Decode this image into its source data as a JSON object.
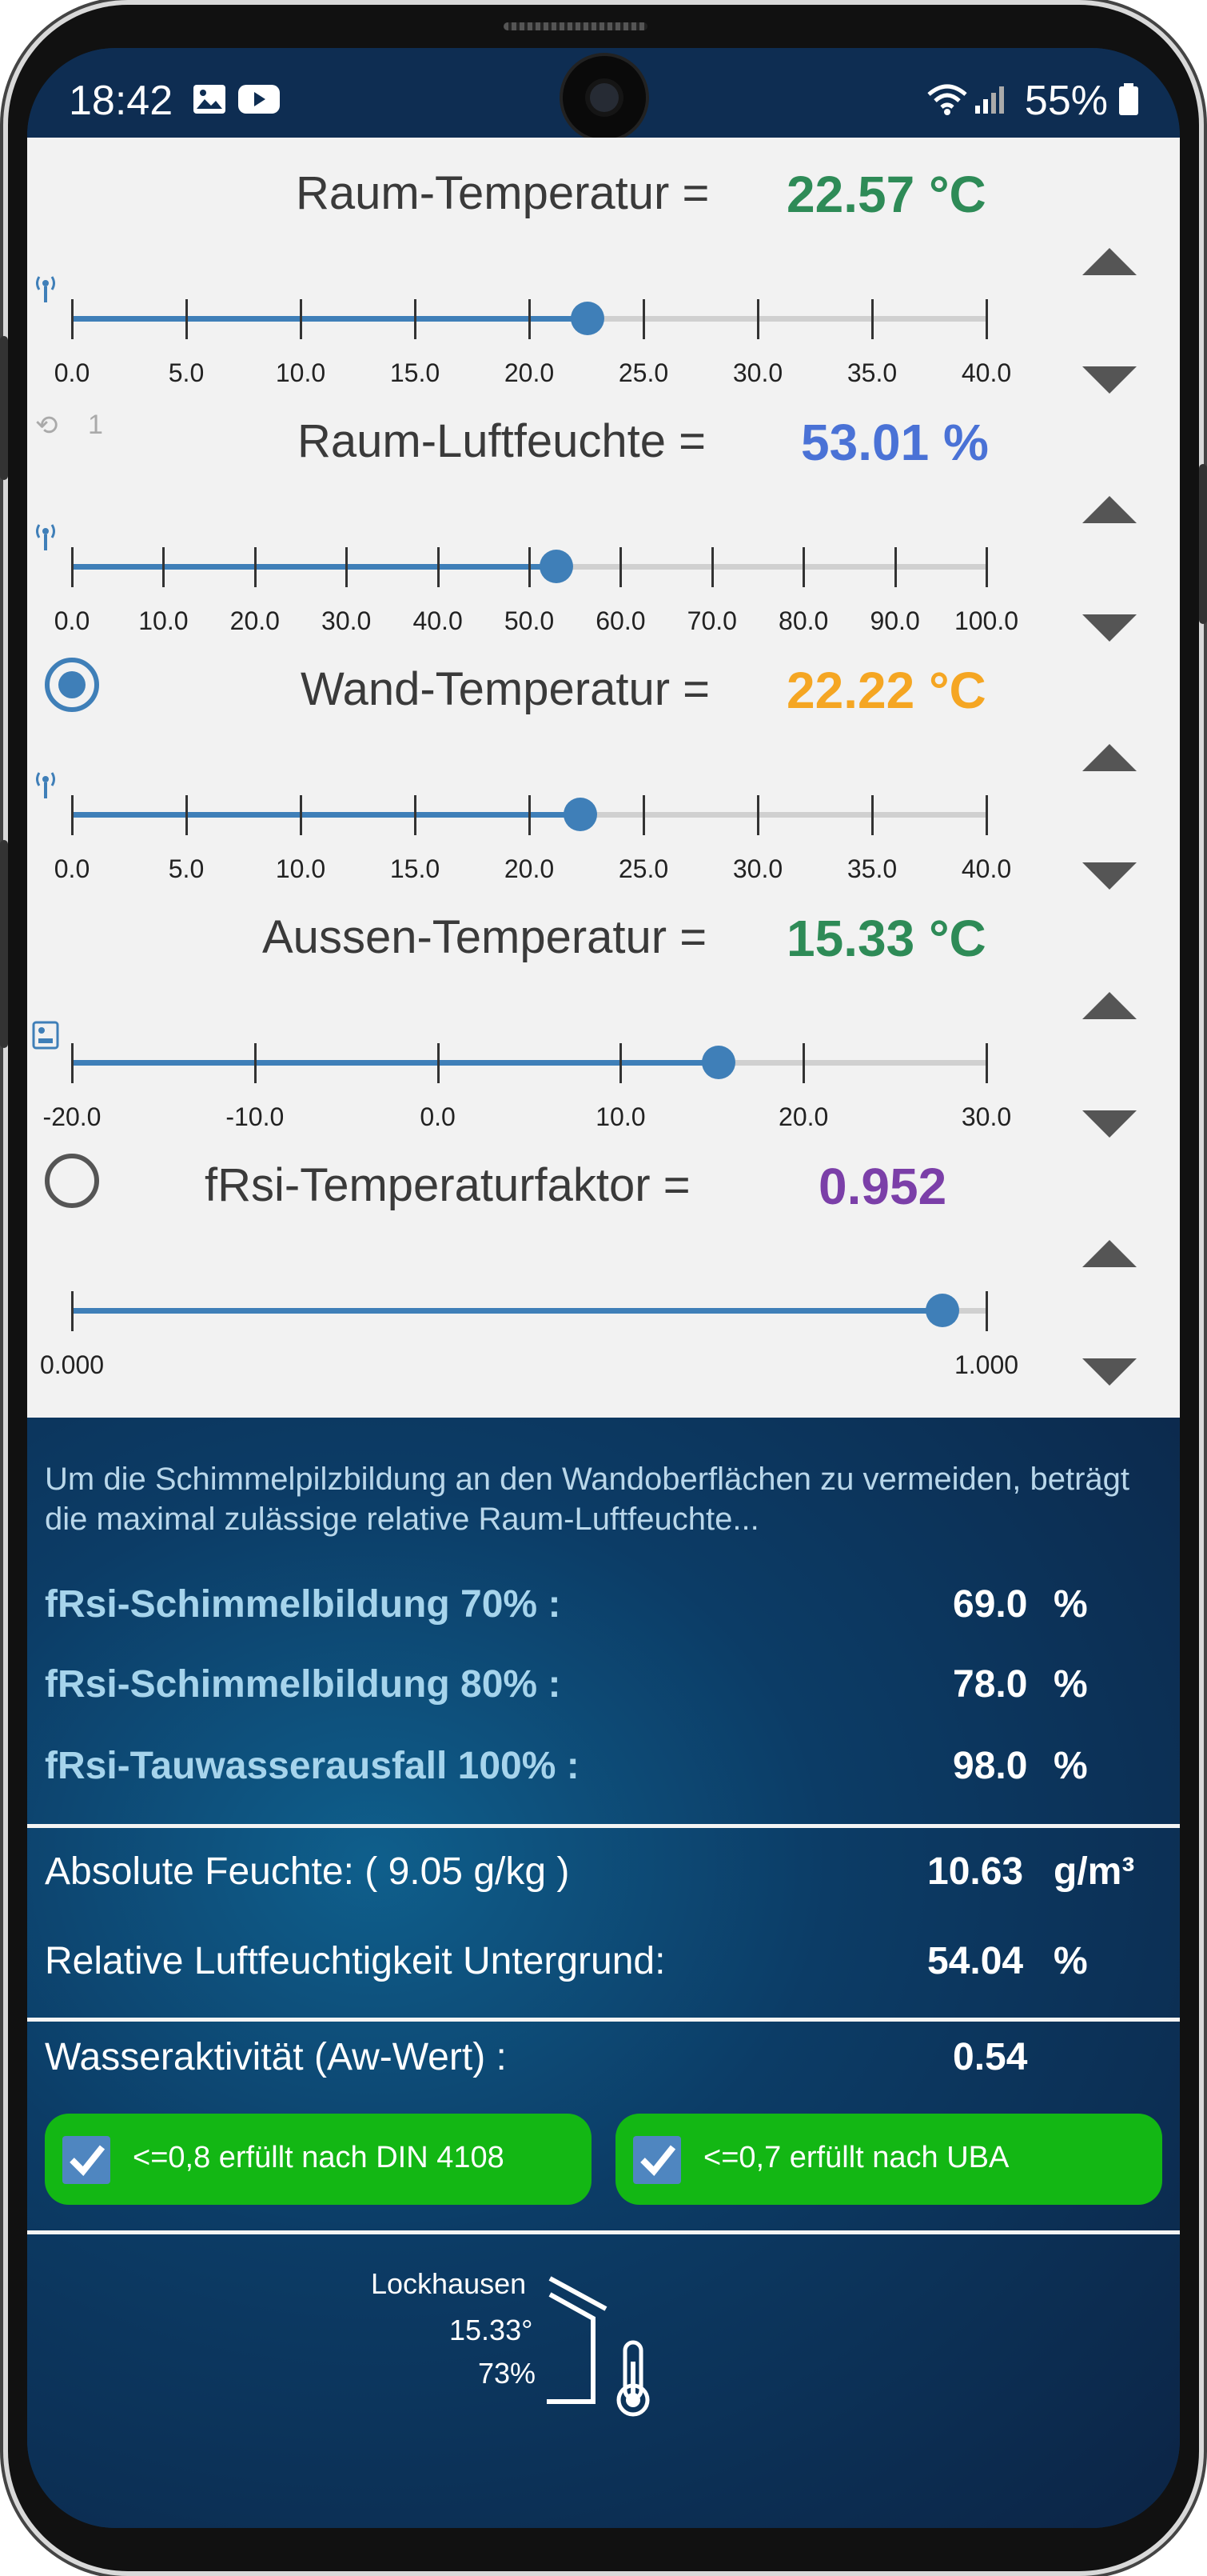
{
  "status_bar": {
    "time": "18:42",
    "battery": "55%"
  },
  "sliders": [
    {
      "label": "Raum-Temperatur =",
      "value": "22.57 °C",
      "value_color": "#2e8b57",
      "level": 0.564,
      "ticks": [
        "0.0",
        "5.0",
        "10.0",
        "15.0",
        "20.0",
        "25.0",
        "30.0",
        "35.0",
        "40.0"
      ],
      "left_icon": "antenna-icon"
    },
    {
      "label": "Raum-Luftfeuchte =",
      "value": "53.01 %",
      "value_color": "#4a72d6",
      "level": 0.53,
      "history": "1",
      "ticks": [
        "0.0",
        "10.0",
        "20.0",
        "30.0",
        "40.0",
        "50.0",
        "60.0",
        "70.0",
        "80.0",
        "90.0",
        "100.0"
      ],
      "left_icon": "antenna-icon"
    },
    {
      "label": "Wand-Temperatur =",
      "value": "22.22 °C",
      "value_color": "#f5a623",
      "level": 0.556,
      "radio": true,
      "ticks": [
        "0.0",
        "5.0",
        "10.0",
        "15.0",
        "20.0",
        "25.0",
        "30.0",
        "35.0",
        "40.0"
      ],
      "left_icon": "antenna-icon"
    },
    {
      "label": "Aussen-Temperatur =",
      "value": "15.33 °C",
      "value_color": "#2e8b57",
      "level": 0.707,
      "ticks": [
        "-20.0",
        "-10.0",
        "0.0",
        "10.0",
        "20.0",
        "30.0"
      ],
      "left_icon": "weather-station-icon"
    },
    {
      "label": "fRsi-Temperaturfaktor =",
      "value": "0.952",
      "value_color": "#7b3fa8",
      "level": 0.952,
      "radio": false,
      "ticks": [
        "0.000",
        "1.000"
      ]
    }
  ],
  "results": {
    "intro": "Um die Schimmelpilzbildung an den Wandoberflächen zu vermeiden, beträgt die maximal zulässige relative Raum-Luftfeuchte...",
    "frsi": [
      {
        "label": "fRsi-Schimmelbildung 70% :",
        "value": "69.0",
        "unit": "%"
      },
      {
        "label": "fRsi-Schimmelbildung 80% :",
        "value": "78.0",
        "unit": "%"
      },
      {
        "label": "fRsi-Tauwasserausfall 100% :",
        "value": "98.0",
        "unit": "%"
      }
    ],
    "absolute": {
      "label": "Absolute Feuchte:  ( 9.05 g/kg )",
      "value": "10.63",
      "unit": "g/m³"
    },
    "relative": {
      "label": "Relative Luftfeuchtigkeit Untergrund:",
      "value": "54.04",
      "unit": "%"
    },
    "aw": {
      "label": "Wasseraktivität (Aw-Wert) :",
      "value": "0.54"
    },
    "badges": [
      {
        "text": "<=0,8 erfüllt nach DIN 4108"
      },
      {
        "text": "<=0,7 erfüllt nach UBA"
      }
    ],
    "location": {
      "name": "Lockhausen",
      "temp": "15.33°",
      "humidity": "73%"
    }
  }
}
